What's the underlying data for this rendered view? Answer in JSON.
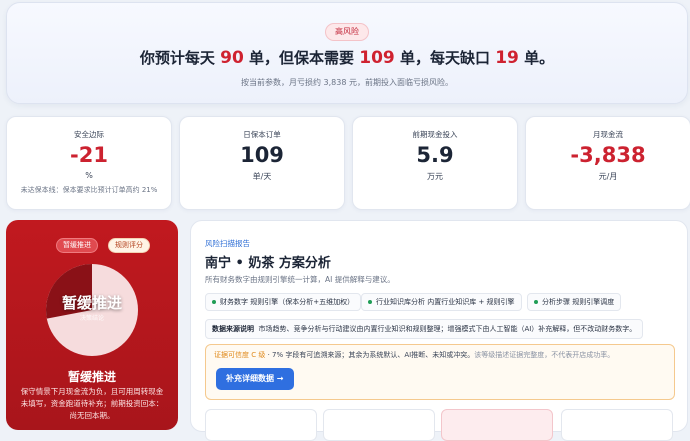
{
  "hero": {
    "badge": "高风险",
    "headline": {
      "p1": "你预计每天 ",
      "forecast": "90",
      "p2": " 单，但保本需要 ",
      "breakeven": "109",
      "p3": " 单，每天缺口 ",
      "gap": "19",
      "p4": " 单。"
    },
    "subline": "按当前参数，月亏损约 3,838 元，前期投入面临亏损风险。"
  },
  "kpis": [
    {
      "label": "安全边际",
      "value": "-21",
      "unit": "%",
      "note": "未达保本线：保本要求比预计订单高约 21%",
      "negative": true
    },
    {
      "label": "日保本订单",
      "value": "109",
      "unit": "单/天",
      "note": "",
      "negative": false
    },
    {
      "label": "前期现金投入",
      "value": "5.9",
      "unit": "万元",
      "note": "",
      "negative": false
    },
    {
      "label": "月现金流",
      "value": "-3,838",
      "unit": "元/月",
      "note": "",
      "negative": true
    }
  ],
  "decision": {
    "status_pill": "暂缓推进",
    "rating_pill": "规则评分",
    "pie_title": "暂缓推进",
    "pie_sub": "决策结论",
    "pie_fraction": 0.28,
    "title": "暂缓推进",
    "desc_line1": "保守情景下月现金流为负，且可用周转现金",
    "desc_line2": "未填写，资金跑道待补充；前期投资回本：",
    "desc_line3": "尚无回本期。"
  },
  "report": {
    "kicker": "风险扫描报告",
    "title": "南宁 • 奶茶 方案分析",
    "desc": "所有财务数字由规则引擎统一计算，AI 提供解释与建议。",
    "tags": [
      "财务数字  规则引擎（保本分析+五维加权）",
      "行业知识库分析  内置行业知识库 + 规则引擎",
      "分析步骤  规则引擎调度"
    ],
    "source_label": "数据来源说明",
    "source_text": "市场趋势、竞争分析与行动建议由内置行业知识和规则整理；增强模式下由人工智能（AI）补充解释，但不改动财务数字。",
    "confidence_level": "证据可信度 C 级",
    "confidence_text": " · 7% 字段有可追溯来源；其余为系统默认、AI推断、未知或冲突。",
    "confidence_muted": "该等级描述证据完整度，不代表开店成功率。",
    "button_label": "补充详细数据 →"
  },
  "colors": {
    "danger": "#cc2230",
    "primary": "#2f6fe0",
    "decision_bg": "#c1191f",
    "warning": "#e08a1c"
  }
}
